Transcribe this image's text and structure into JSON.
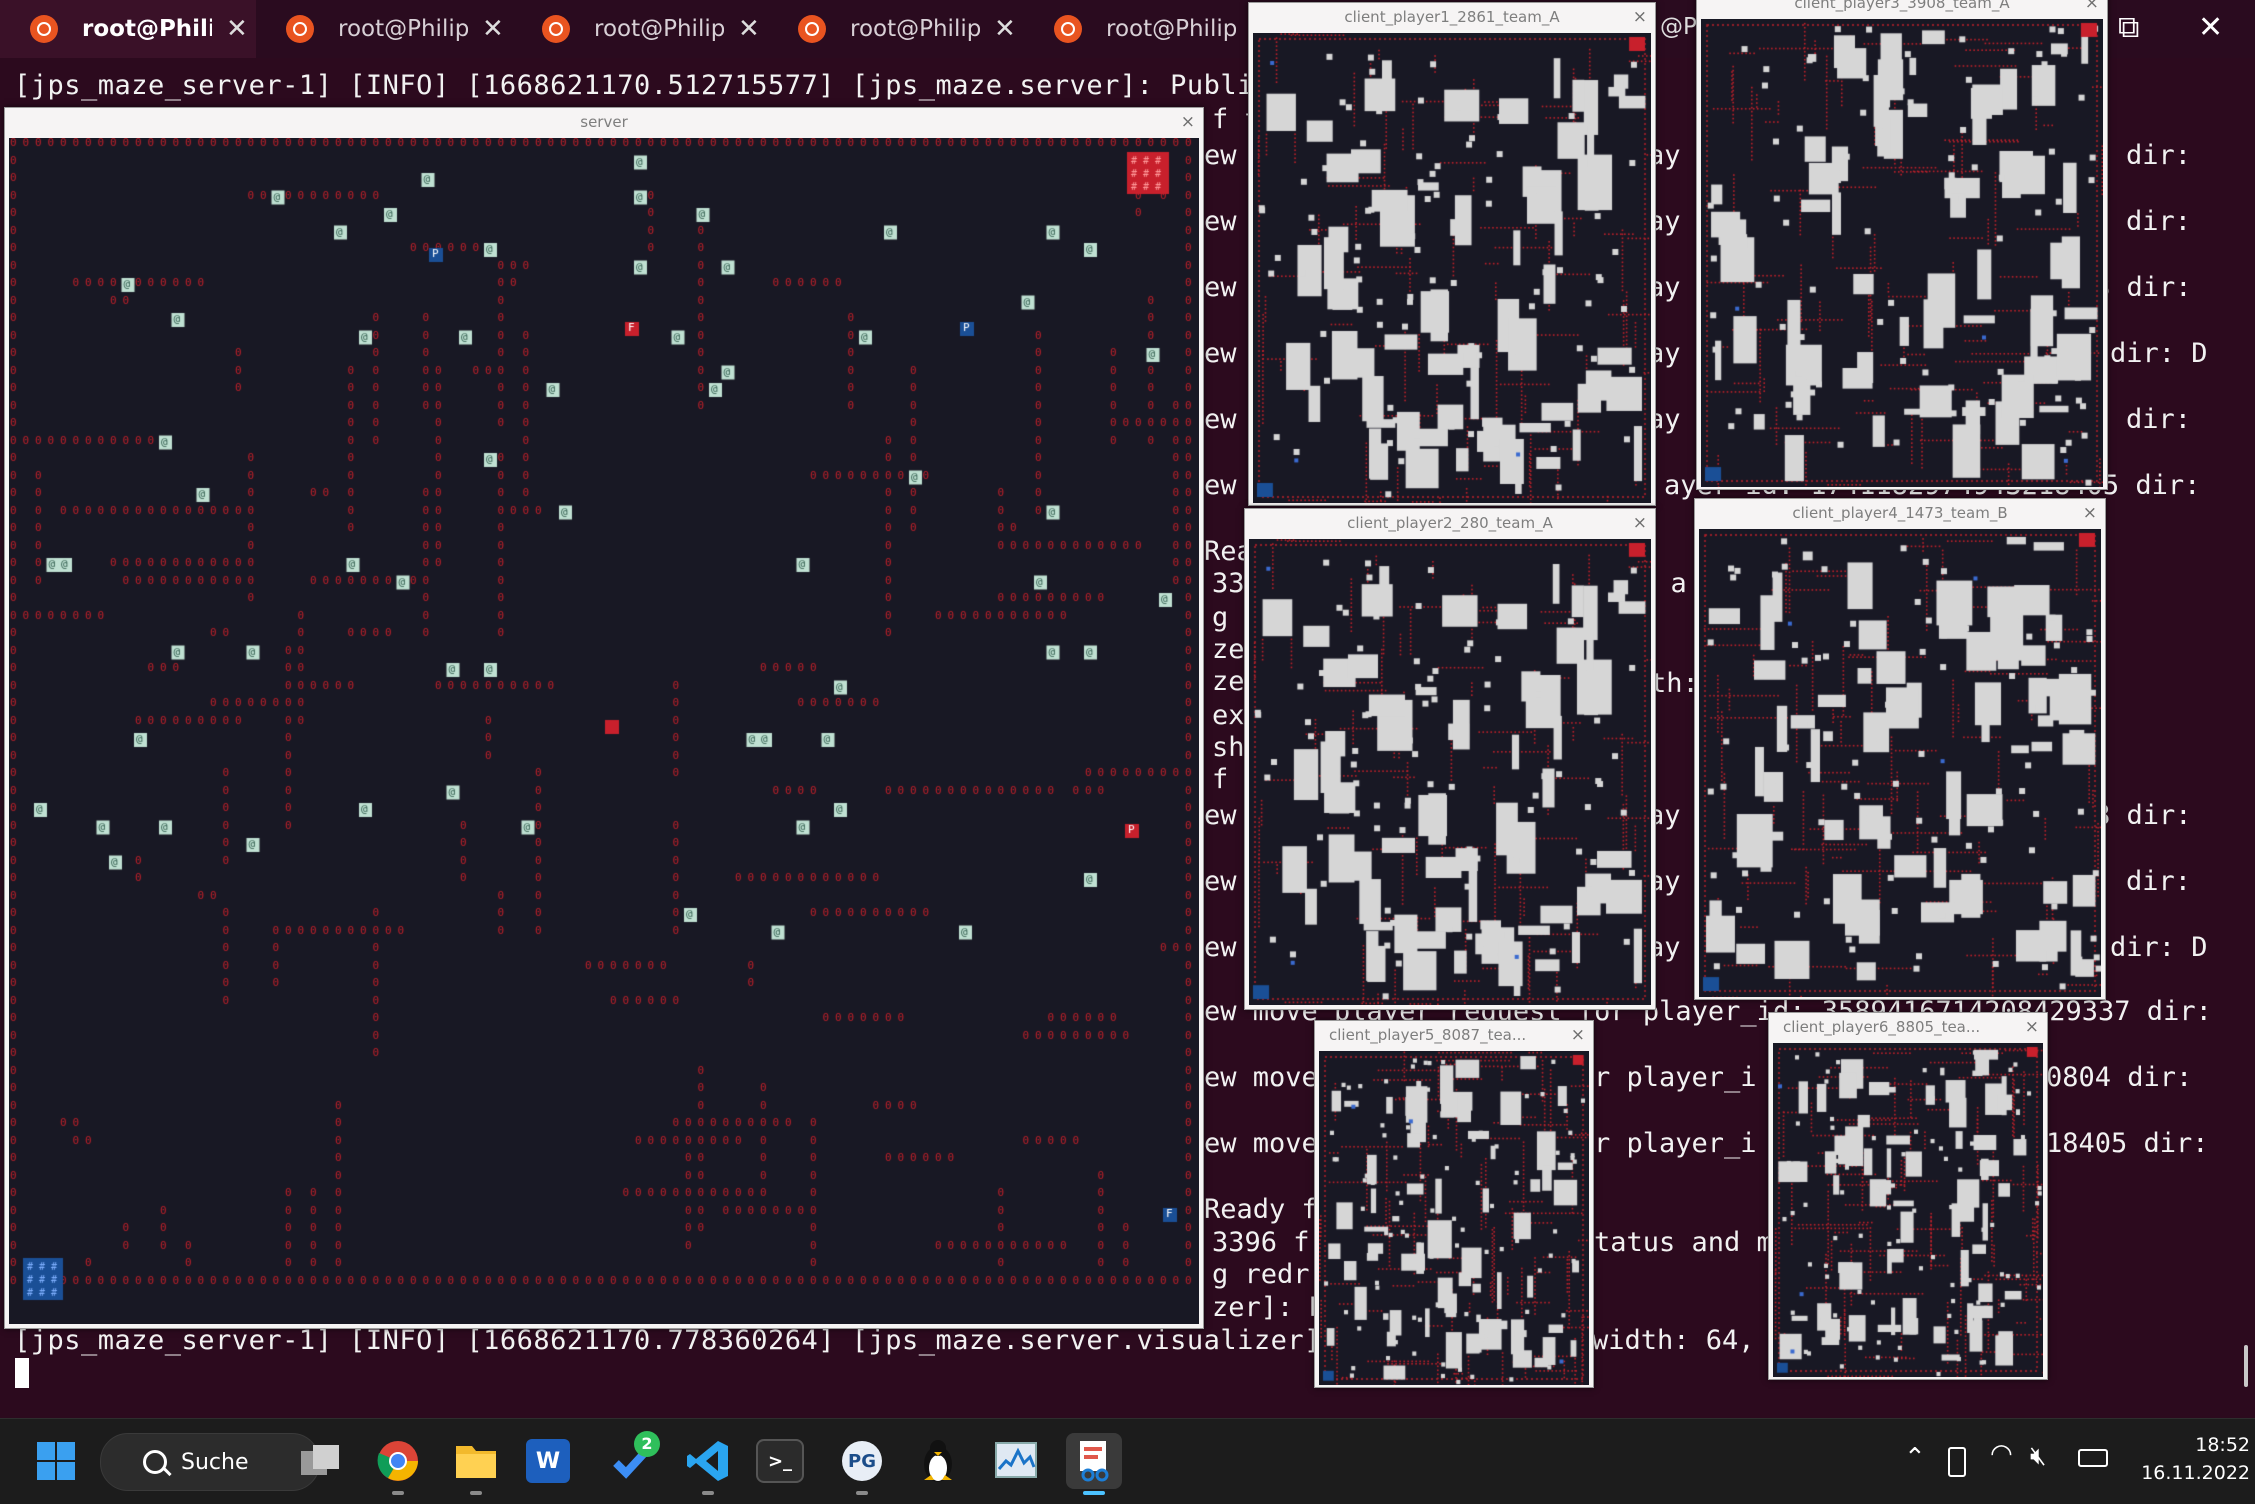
{
  "colors": {
    "terminal_bg": "#2c0a1e",
    "maze_bg": "#181824",
    "trail_red": "#c0202a",
    "team_a_red": "#c8202c",
    "team_b_blue": "#1a4f96",
    "player_tile": "#bfe0d2",
    "wall_white": "#d6d6d6"
  },
  "terminal": {
    "tabs": [
      {
        "label": "root@Philipp",
        "active": true
      },
      {
        "label": "root@Philipp",
        "active": false
      },
      {
        "label": "root@Philipp",
        "active": false
      },
      {
        "label": "root@Philipp",
        "active": false
      },
      {
        "label": "root@Philipp",
        "active": false
      }
    ],
    "hidden_tab_fragment": "@P",
    "window_controls": {
      "restore": "⧉",
      "close": "✕"
    },
    "line_top": "[jps_maze_server-1] [INFO] [1668621170.512715577] [jps_maze.server]: Publishi",
    "line_bottom": "[jps_maze_server-1] [INFO] [1668621170.778360264] [jps_maze.server.visualizer]: S",
    "line_bottom_tail": "width: 64,",
    "fragments_mid": [
      "f t",
      "ew",
      "ew",
      "ew",
      "ew",
      "ew",
      "ew",
      "Rea",
      "33",
      "g",
      "zer",
      "zer",
      "ex",
      "shi",
      "f t",
      "ew",
      "ew",
      "ew",
      "ew move player request for player_id: 3589416714208429337 dir:",
      "ew move",
      "ew move",
      "Ready f",
      "3396 f",
      "g redr",
      "zer]: R"
    ],
    "fragments_right": [
      "dir:",
      "dir:",
      "8 dir:",
      "dir: D",
      "dir:",
      "ayer_id: 1741182974943218405 dir:",
      "s a",
      "th:",
      "8 dir:",
      "dir:",
      "dir: D",
      "r player_i",
      "0804 dir:",
      "r player_i",
      "18405 dir:",
      "tatus and mo",
      "ay",
      "ay",
      "ay",
      "ay",
      "ay",
      "ay",
      "ay",
      "ay"
    ]
  },
  "windows": {
    "server": {
      "title": "server"
    },
    "client_player1": {
      "title": "client_player1_2861_team_A"
    },
    "client_player3": {
      "title": "client_player3_3908_team_A"
    },
    "client_player2": {
      "title": "client_player2_280_team_A"
    },
    "client_player4": {
      "title": "client_player4_1473_team_B"
    },
    "client_player5": {
      "title": "client_player5_8087_tea..."
    },
    "client_player6": {
      "title": "client_player6_8805_tea..."
    },
    "close_glyph": "×"
  },
  "maze_legend": {
    "trail_char": "0",
    "player_char": "@",
    "pickup_char": "P",
    "flag_char": "F",
    "base_char": "#"
  },
  "taskbar": {
    "search_label": "Suche",
    "todo_badge": "2",
    "apps": [
      {
        "icon": "windows-start-icon"
      },
      {
        "icon": "task-view-icon"
      },
      {
        "icon": "chrome-icon"
      },
      {
        "icon": "file-explorer-icon"
      },
      {
        "icon": "word-icon",
        "glyph": "W"
      },
      {
        "icon": "todo-icon"
      },
      {
        "icon": "vscode-icon"
      },
      {
        "icon": "terminal-icon",
        "glyph": ">_"
      },
      {
        "icon": "pgadmin-icon",
        "glyph": "PG"
      },
      {
        "icon": "linux-penguin-icon"
      },
      {
        "icon": "resource-monitor-icon"
      },
      {
        "icon": "snipping-tool-icon"
      }
    ],
    "time": "18:52",
    "date": "16.11.2022"
  }
}
